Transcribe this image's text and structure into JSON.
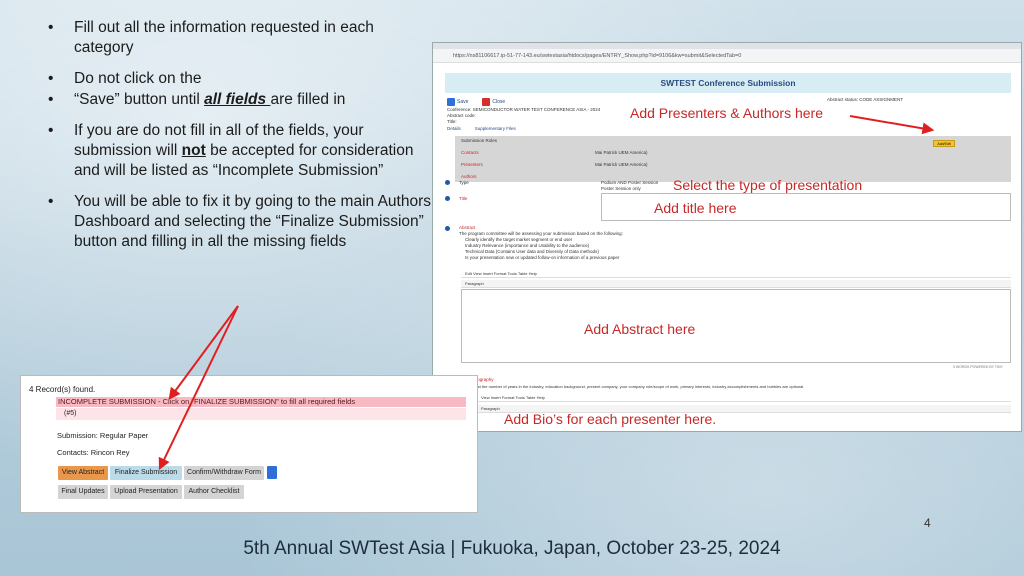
{
  "bullets": {
    "b1": "Fill out all the information requested in each category",
    "b2": "Do not click on the",
    "b3_pre": "“Save” button until ",
    "b3_em": "all fields ",
    "b3_post": "are filled in",
    "b4_pre": "If you are do not fill in all of the fields, your submission will ",
    "b4_strong": "not",
    "b4_post": " be accepted for consideration and will be listed as “Incomplete Submission”",
    "b5": "You will be able to fix it by going to the main Authors Dashboard and selecting the “Finalize Submission” button and filling in all the missing fields"
  },
  "browser": {
    "url": "https://ns81106617.ip-51-77-143.eu/swtestasia/htdocs/pages/ENTRY_Show.php?id=9106&kw=submit&SelectedTab=0",
    "title": "SWTEST Conference Submission",
    "save_label": "Save",
    "close_label": "Close",
    "conference": "Conference: SEMICONDUCTOR WATER TEST CONFERENCE ASIA - 2024",
    "abstract_code": "Abstract code:",
    "title_field": "Title:",
    "abstract_status": "Abstract status: CODE ASSIGNMENT",
    "details_tab": "Details",
    "files_tab": "Supplementary Files",
    "panel_header": "Submission Roles",
    "contacts_label": "Contacts",
    "contacts_val": "Mai Patrick UEM America)",
    "presenters_label": "Presenters",
    "presenters_val": "Mai Patrick UEM America)",
    "authors_label": "Authors",
    "add_btn": "Add/Edit",
    "type_label": "Type",
    "type_opt1": "Podium AND Poster Session",
    "type_opt2": "Poster Session only",
    "title_label": "Title",
    "abstract_label": "Abstract",
    "abstract_help": "The program committee will be assessing your submission based on the following:",
    "abstract_b1": "Clearly identify the target market segment or end user",
    "abstract_b2": "Industry Relevance (importance and Usability to the audience)",
    "abstract_b3": "Technical Data (Contains User data and Diversity of Data methods)",
    "abstract_b4": "Is your presentation new or updated follow-on information of a previous paper",
    "editor_menu": "Edit   View   Insert   Format   Tools   Table   Help",
    "editor_para": "Paragraph",
    "word_count": "0 WORDS  POWERED BY TINY",
    "bio_label": "Bio / Biography",
    "bio_help": "should list the number of years in the industry, education background, present company, your company role/scope of work, primary interests, industry accomplishments and hobbies are optional.",
    "editor_menu2": "View   Insert   Format   Tools   Table   Help"
  },
  "annotations": {
    "presenters": "Add Presenters & Authors here",
    "type": "Select the type of presentation",
    "title": "Add title here",
    "abstract": "Add Abstract here",
    "bio": "Add Bio’s for each presenter here."
  },
  "records": {
    "count": "4 Record(s) found.",
    "incomplete": "INCOMPLETE SUBMISSION - Click on \"FINALIZE SUBMISSION\" to fill all required fields",
    "id": "(#5)",
    "submission": "Submission: Regular Paper",
    "contacts": "Contacts: Rincon Rey",
    "btn_view": "View Abstract",
    "btn_finalize": "Finalize Submission",
    "btn_confirm": "Confirm/Withdraw Form",
    "btn_final_updates": "Final Updates",
    "btn_upload": "Upload Presentation",
    "btn_checklist": "Author Checklist"
  },
  "page_number": "4",
  "footer": "5th Annual SWTest Asia | Fukuoka, Japan, October 23-25, 2024",
  "colors": {
    "annotation_red": "#c62828",
    "accent_blue": "#2b4c7e"
  }
}
